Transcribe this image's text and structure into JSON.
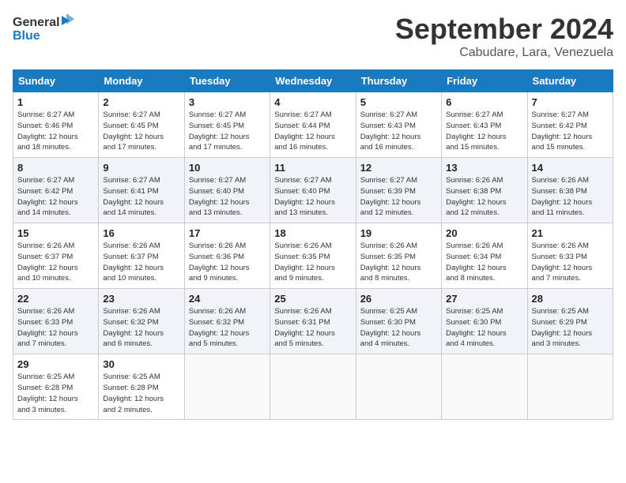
{
  "header": {
    "logo_line1": "General",
    "logo_line2": "Blue",
    "month_title": "September 2024",
    "subtitle": "Cabudare, Lara, Venezuela"
  },
  "weekdays": [
    "Sunday",
    "Monday",
    "Tuesday",
    "Wednesday",
    "Thursday",
    "Friday",
    "Saturday"
  ],
  "weeks": [
    [
      {
        "day": "1",
        "info": "Sunrise: 6:27 AM\nSunset: 6:46 PM\nDaylight: 12 hours\nand 18 minutes."
      },
      {
        "day": "2",
        "info": "Sunrise: 6:27 AM\nSunset: 6:45 PM\nDaylight: 12 hours\nand 17 minutes."
      },
      {
        "day": "3",
        "info": "Sunrise: 6:27 AM\nSunset: 6:45 PM\nDaylight: 12 hours\nand 17 minutes."
      },
      {
        "day": "4",
        "info": "Sunrise: 6:27 AM\nSunset: 6:44 PM\nDaylight: 12 hours\nand 16 minutes."
      },
      {
        "day": "5",
        "info": "Sunrise: 6:27 AM\nSunset: 6:43 PM\nDaylight: 12 hours\nand 16 minutes."
      },
      {
        "day": "6",
        "info": "Sunrise: 6:27 AM\nSunset: 6:43 PM\nDaylight: 12 hours\nand 15 minutes."
      },
      {
        "day": "7",
        "info": "Sunrise: 6:27 AM\nSunset: 6:42 PM\nDaylight: 12 hours\nand 15 minutes."
      }
    ],
    [
      {
        "day": "8",
        "info": "Sunrise: 6:27 AM\nSunset: 6:42 PM\nDaylight: 12 hours\nand 14 minutes."
      },
      {
        "day": "9",
        "info": "Sunrise: 6:27 AM\nSunset: 6:41 PM\nDaylight: 12 hours\nand 14 minutes."
      },
      {
        "day": "10",
        "info": "Sunrise: 6:27 AM\nSunset: 6:40 PM\nDaylight: 12 hours\nand 13 minutes."
      },
      {
        "day": "11",
        "info": "Sunrise: 6:27 AM\nSunset: 6:40 PM\nDaylight: 12 hours\nand 13 minutes."
      },
      {
        "day": "12",
        "info": "Sunrise: 6:27 AM\nSunset: 6:39 PM\nDaylight: 12 hours\nand 12 minutes."
      },
      {
        "day": "13",
        "info": "Sunrise: 6:26 AM\nSunset: 6:38 PM\nDaylight: 12 hours\nand 12 minutes."
      },
      {
        "day": "14",
        "info": "Sunrise: 6:26 AM\nSunset: 6:38 PM\nDaylight: 12 hours\nand 11 minutes."
      }
    ],
    [
      {
        "day": "15",
        "info": "Sunrise: 6:26 AM\nSunset: 6:37 PM\nDaylight: 12 hours\nand 10 minutes."
      },
      {
        "day": "16",
        "info": "Sunrise: 6:26 AM\nSunset: 6:37 PM\nDaylight: 12 hours\nand 10 minutes."
      },
      {
        "day": "17",
        "info": "Sunrise: 6:26 AM\nSunset: 6:36 PM\nDaylight: 12 hours\nand 9 minutes."
      },
      {
        "day": "18",
        "info": "Sunrise: 6:26 AM\nSunset: 6:35 PM\nDaylight: 12 hours\nand 9 minutes."
      },
      {
        "day": "19",
        "info": "Sunrise: 6:26 AM\nSunset: 6:35 PM\nDaylight: 12 hours\nand 8 minutes."
      },
      {
        "day": "20",
        "info": "Sunrise: 6:26 AM\nSunset: 6:34 PM\nDaylight: 12 hours\nand 8 minutes."
      },
      {
        "day": "21",
        "info": "Sunrise: 6:26 AM\nSunset: 6:33 PM\nDaylight: 12 hours\nand 7 minutes."
      }
    ],
    [
      {
        "day": "22",
        "info": "Sunrise: 6:26 AM\nSunset: 6:33 PM\nDaylight: 12 hours\nand 7 minutes."
      },
      {
        "day": "23",
        "info": "Sunrise: 6:26 AM\nSunset: 6:32 PM\nDaylight: 12 hours\nand 6 minutes."
      },
      {
        "day": "24",
        "info": "Sunrise: 6:26 AM\nSunset: 6:32 PM\nDaylight: 12 hours\nand 5 minutes."
      },
      {
        "day": "25",
        "info": "Sunrise: 6:26 AM\nSunset: 6:31 PM\nDaylight: 12 hours\nand 5 minutes."
      },
      {
        "day": "26",
        "info": "Sunrise: 6:25 AM\nSunset: 6:30 PM\nDaylight: 12 hours\nand 4 minutes."
      },
      {
        "day": "27",
        "info": "Sunrise: 6:25 AM\nSunset: 6:30 PM\nDaylight: 12 hours\nand 4 minutes."
      },
      {
        "day": "28",
        "info": "Sunrise: 6:25 AM\nSunset: 6:29 PM\nDaylight: 12 hours\nand 3 minutes."
      }
    ],
    [
      {
        "day": "29",
        "info": "Sunrise: 6:25 AM\nSunset: 6:28 PM\nDaylight: 12 hours\nand 3 minutes."
      },
      {
        "day": "30",
        "info": "Sunrise: 6:25 AM\nSunset: 6:28 PM\nDaylight: 12 hours\nand 2 minutes."
      },
      {
        "day": "",
        "info": ""
      },
      {
        "day": "",
        "info": ""
      },
      {
        "day": "",
        "info": ""
      },
      {
        "day": "",
        "info": ""
      },
      {
        "day": "",
        "info": ""
      }
    ]
  ]
}
